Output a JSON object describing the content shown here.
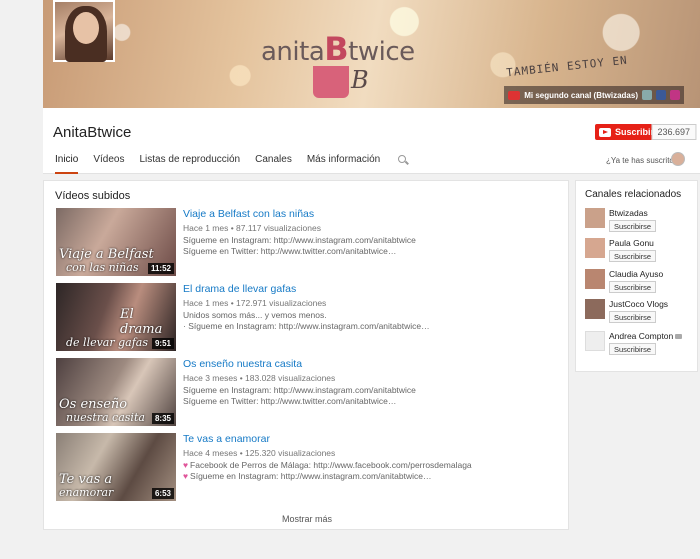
{
  "banner": {
    "logo_pre": "anita",
    "logo_big": "B",
    "logo_post": "twice",
    "mug_letter": "B",
    "tagline": "TAMBIÉN ESTOY EN",
    "second_channel_link": "Mi segundo canal (Btwizadas)"
  },
  "header": {
    "channel_name": "AnitaBtwice",
    "subscribe_label": "Suscribirse",
    "subscriber_count": "236.697",
    "subscribed_question": "¿Ya te has suscrito?",
    "tabs": [
      {
        "label": "Inicio",
        "active": true
      },
      {
        "label": "Vídeos"
      },
      {
        "label": "Listas de reproducción"
      },
      {
        "label": "Canales"
      },
      {
        "label": "Más información"
      }
    ]
  },
  "uploads": {
    "title": "Vídeos subidos",
    "show_more": "Mostrar más",
    "videos": [
      {
        "title": "Viaje a Belfast con las niñas",
        "meta": "Hace 1 mes • 87.117 visualizaciones",
        "desc1": "Sígueme en Instagram: http://www.instagram.com/anitabtwice",
        "desc2": "Sígueme en Twitter: http://www.twitter.com/anitabtwice…",
        "duration": "11:52",
        "thumb_text1": "Viaje a Belfast",
        "thumb_text2": "con las niñas"
      },
      {
        "title": "El drama de llevar gafas",
        "meta": "Hace 1 mes • 172.971 visualizaciones",
        "desc1": "Unidos somos más... y vemos menos.",
        "desc2": "· Sígueme en Instagram: http://www.instagram.com/anitabtwice…",
        "duration": "9:51",
        "thumb_text1": "El drama",
        "thumb_text2": "de llevar gafas"
      },
      {
        "title": "Os enseño nuestra casita",
        "meta": "Hace 3 meses • 183.028 visualizaciones",
        "desc1": "Sígueme en Instagram: http://www.instagram.com/anitabtwice",
        "desc2": "Sígueme en Twitter: http://www.twitter.com/anitabtwice…",
        "duration": "8:35",
        "thumb_text1": "Os enseño",
        "thumb_text2": "nuestra casita"
      },
      {
        "title": "Te vas a enamorar",
        "meta": "Hace 4 meses • 125.320 visualizaciones",
        "desc1": "Facebook de Perros de Málaga: http://www.facebook.com/perrosdemalaga",
        "desc2": "Sígueme en Instagram: http://www.instagram.com/anitabtwice…",
        "duration": "6:53",
        "thumb_text1": "Te vas a",
        "thumb_text2": "enamorar"
      }
    ]
  },
  "related": {
    "title": "Canales relacionados",
    "subscribe_label": "Suscribirse",
    "channels": [
      {
        "name": "Btwizadas"
      },
      {
        "name": "Paula Gonu"
      },
      {
        "name": "Claudia Ayuso"
      },
      {
        "name": "JustCoco Vlogs"
      },
      {
        "name": "Andrea Compton"
      }
    ]
  },
  "colors": {
    "accent_red": "#e62117",
    "link_blue": "#167ac6"
  }
}
